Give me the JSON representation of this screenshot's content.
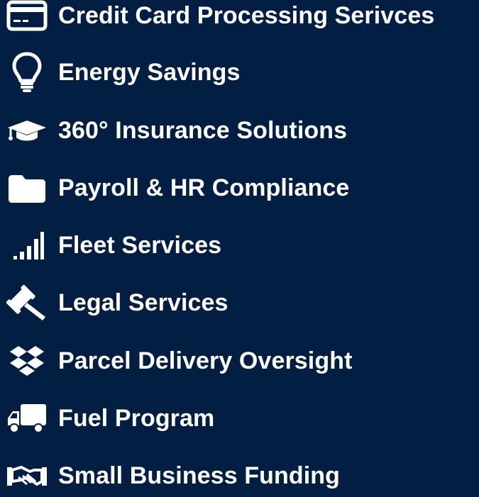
{
  "theme": {
    "background": "#031e43",
    "text": "#ffffff"
  },
  "services": [
    {
      "label": "Credit Card Processing Serivces",
      "icon": "credit-card-icon"
    },
    {
      "label": "Energy Savings",
      "icon": "lightbulb-icon"
    },
    {
      "label": "360° Insurance Solutions",
      "icon": "graduation-cap-icon"
    },
    {
      "label": "Payroll & HR Compliance",
      "icon": "folder-icon"
    },
    {
      "label": "Fleet Services",
      "icon": "signal-bars-icon"
    },
    {
      "label": "Legal Services",
      "icon": "gavel-icon"
    },
    {
      "label": "Parcel Delivery Oversight",
      "icon": "dropbox-icon"
    },
    {
      "label": "Fuel Program",
      "icon": "truck-icon"
    },
    {
      "label": "Small Business Funding",
      "icon": "handshake-icon"
    }
  ]
}
